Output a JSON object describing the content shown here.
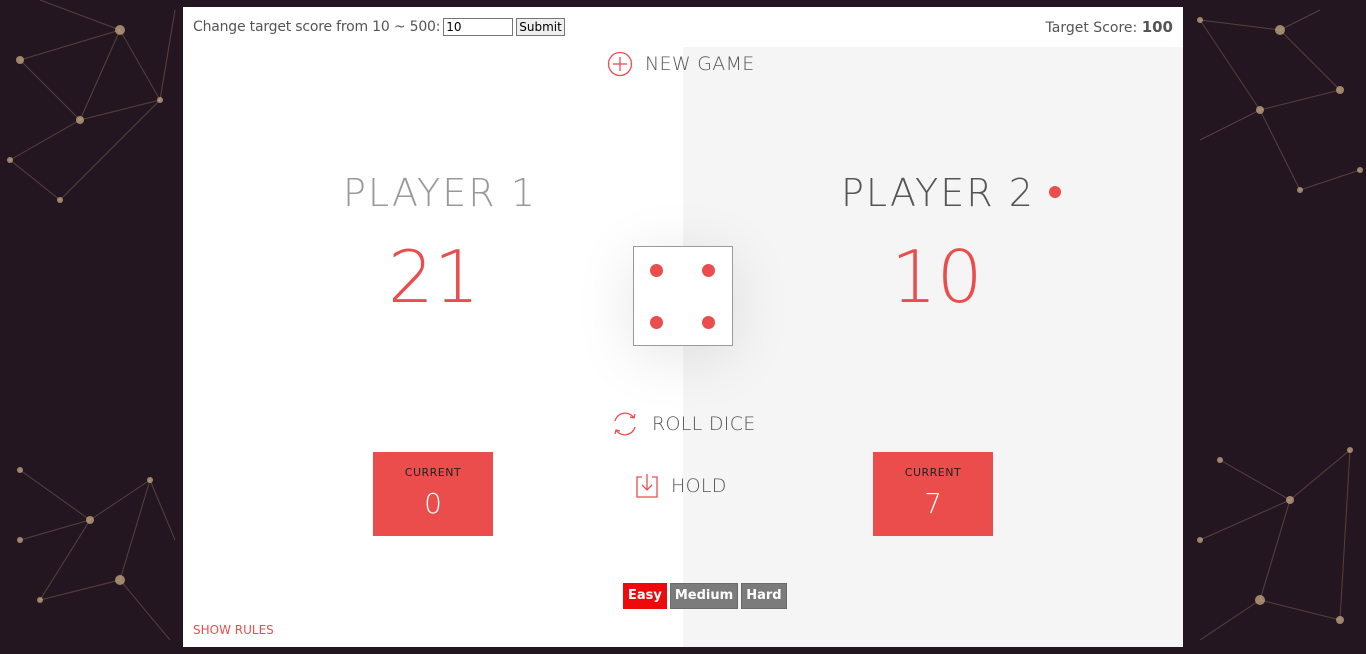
{
  "target_form": {
    "label": "Change target score from 10 ~ 500:",
    "input_value": "10",
    "submit_label": "Submit"
  },
  "target_display": {
    "label": "Target Score: ",
    "value": "100"
  },
  "buttons": {
    "new_game": "NEW GAME",
    "roll_dice": "ROLL DICE",
    "hold": "HOLD"
  },
  "players": [
    {
      "name": "PLAYER 1",
      "score": "21",
      "current_label": "CURRENT",
      "current_score": "0",
      "active": false
    },
    {
      "name": "PLAYER 2",
      "score": "10",
      "current_label": "CURRENT",
      "current_score": "7",
      "active": true
    }
  ],
  "dice": {
    "value": 4
  },
  "difficulty": {
    "options": [
      "Easy",
      "Medium",
      "Hard"
    ],
    "selected": "Easy"
  },
  "show_rules": "SHOW RULES",
  "colors": {
    "accent": "#eb4d4d",
    "easy_active": "#ee0a0a",
    "inactive_button": "#7b7b7b",
    "background": "#241620",
    "right_panel": "#f5f5f5"
  },
  "icons": {
    "new_game": "plus-circle-icon",
    "roll_dice": "refresh-icon",
    "hold": "download-icon"
  }
}
